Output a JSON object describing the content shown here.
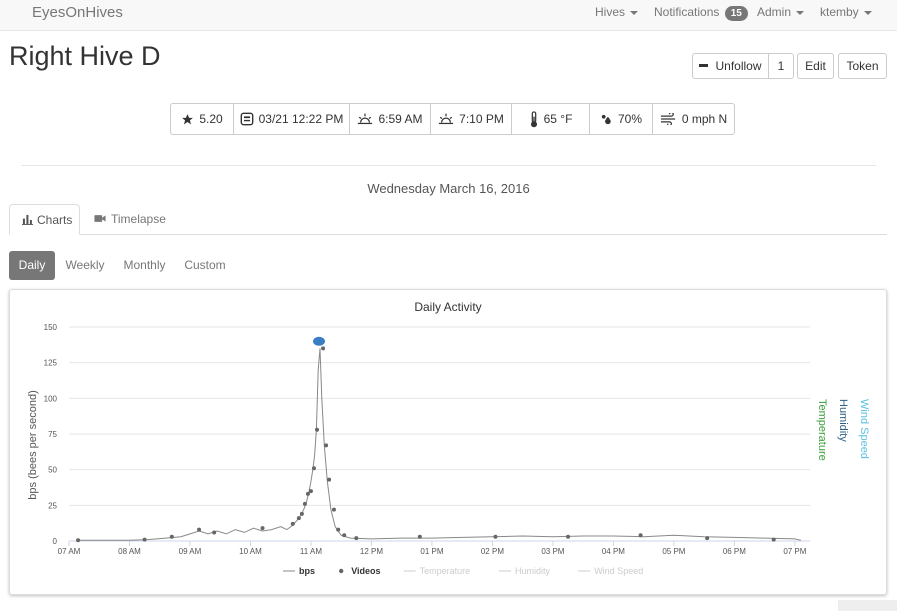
{
  "navbar": {
    "brand": "EyesOnHives",
    "hives": "Hives",
    "notifications_label": "Notifications",
    "notifications_count": "15",
    "admin": "Admin",
    "user": "ktemby"
  },
  "header": {
    "title": "Right Hive D",
    "unfollow_label": "Unfollow",
    "follower_count": "1",
    "edit_label": "Edit",
    "token_label": "Token"
  },
  "stats": {
    "rating": "5.20",
    "last_update": "03/21 12:22 PM",
    "sunrise": "6:59 AM",
    "sunset": "7:10 PM",
    "temperature": "65 °F",
    "humidity": "70%",
    "wind": "0 mph N"
  },
  "date_label": "Wednesday March 16, 2016",
  "tabs": [
    {
      "label": "Charts",
      "icon": "bar-chart-icon",
      "active": true
    },
    {
      "label": "Timelapse",
      "icon": "video-camera-icon",
      "active": false
    }
  ],
  "ranges": [
    {
      "label": "Daily",
      "active": true
    },
    {
      "label": "Weekly",
      "active": false
    },
    {
      "label": "Monthly",
      "active": false
    },
    {
      "label": "Custom",
      "active": false
    }
  ],
  "colors": {
    "bps_line": "#888888",
    "videos_marker": "#666666",
    "highlight": "#3a7fc4",
    "temperature": "#3a9d3a",
    "humidity": "#2f5f86",
    "wind_speed": "#5bc0de",
    "legend_inactive": "#cccccc"
  },
  "chart_data": {
    "type": "line",
    "title": "Daily Activity",
    "ylabel": "bps (bees per second)",
    "right_axis_labels": [
      "Temperature",
      "Humidity",
      "Wind Speed"
    ],
    "xlim": [
      7.0,
      19.25
    ],
    "ylim": [
      0,
      150
    ],
    "yticks": [
      0,
      25,
      50,
      75,
      100,
      125,
      150
    ],
    "xticks": [
      {
        "value": 7,
        "label": "07 AM"
      },
      {
        "value": 8,
        "label": "08 AM"
      },
      {
        "value": 9,
        "label": "09 AM"
      },
      {
        "value": 10,
        "label": "10 AM"
      },
      {
        "value": 11,
        "label": "11 AM"
      },
      {
        "value": 12,
        "label": "12 PM"
      },
      {
        "value": 13,
        "label": "01 PM"
      },
      {
        "value": 14,
        "label": "02 PM"
      },
      {
        "value": 15,
        "label": "03 PM"
      },
      {
        "value": 16,
        "label": "04 PM"
      },
      {
        "value": 17,
        "label": "05 PM"
      },
      {
        "value": 18,
        "label": "06 PM"
      },
      {
        "value": 19,
        "label": "07 PM"
      }
    ],
    "legend": [
      {
        "name": "bps",
        "active": true
      },
      {
        "name": "Videos",
        "active": true
      },
      {
        "name": "Temperature",
        "active": false
      },
      {
        "name": "Humidity",
        "active": false
      },
      {
        "name": "Wind Speed",
        "active": false
      }
    ],
    "series": [
      {
        "name": "bps",
        "x": [
          7.15,
          7.6,
          8.0,
          8.3,
          8.6,
          8.85,
          9.0,
          9.15,
          9.3,
          9.45,
          9.6,
          9.75,
          9.9,
          10.05,
          10.2,
          10.35,
          10.5,
          10.6,
          10.7,
          10.78,
          10.83,
          10.88,
          10.93,
          10.97,
          11.0,
          11.03,
          11.06,
          11.09,
          11.12,
          11.15,
          11.18,
          11.22,
          11.27,
          11.33,
          11.4,
          11.5,
          11.65,
          12.0,
          12.5,
          13.0,
          13.5,
          14.0,
          14.5,
          15.0,
          15.5,
          16.0,
          16.5,
          17.0,
          17.5,
          18.0,
          18.5,
          19.0,
          19.1
        ],
        "y": [
          0.5,
          0.5,
          0.5,
          1,
          2,
          3,
          5,
          7,
          5,
          7,
          5,
          8,
          6,
          9,
          7,
          8,
          10,
          8,
          11,
          15,
          18,
          22,
          28,
          35,
          42,
          50,
          60,
          78,
          120,
          135,
          100,
          67,
          42,
          22,
          10,
          4,
          2,
          1.5,
          2,
          2,
          2.5,
          3,
          3.5,
          3,
          3.5,
          3.5,
          3,
          4,
          3,
          2.5,
          2,
          1.5,
          0.5
        ]
      },
      {
        "name": "Videos",
        "x": [
          7.15,
          8.25,
          8.7,
          9.15,
          9.4,
          10.2,
          10.7,
          10.8,
          10.85,
          10.9,
          10.95,
          11.0,
          11.05,
          11.1,
          11.15,
          11.2,
          11.25,
          11.3,
          11.38,
          11.45,
          11.55,
          11.75,
          12.8,
          14.05,
          15.25,
          16.45,
          17.55,
          18.65
        ],
        "y": [
          0.5,
          1,
          3,
          8,
          6,
          9,
          12,
          16,
          19,
          26,
          33,
          35,
          51,
          78,
          139,
          135,
          67,
          43,
          22,
          8,
          4,
          2,
          3,
          3,
          3,
          4,
          2,
          1
        ]
      }
    ],
    "highlight_point": {
      "x": 11.1,
      "y": 140
    }
  }
}
